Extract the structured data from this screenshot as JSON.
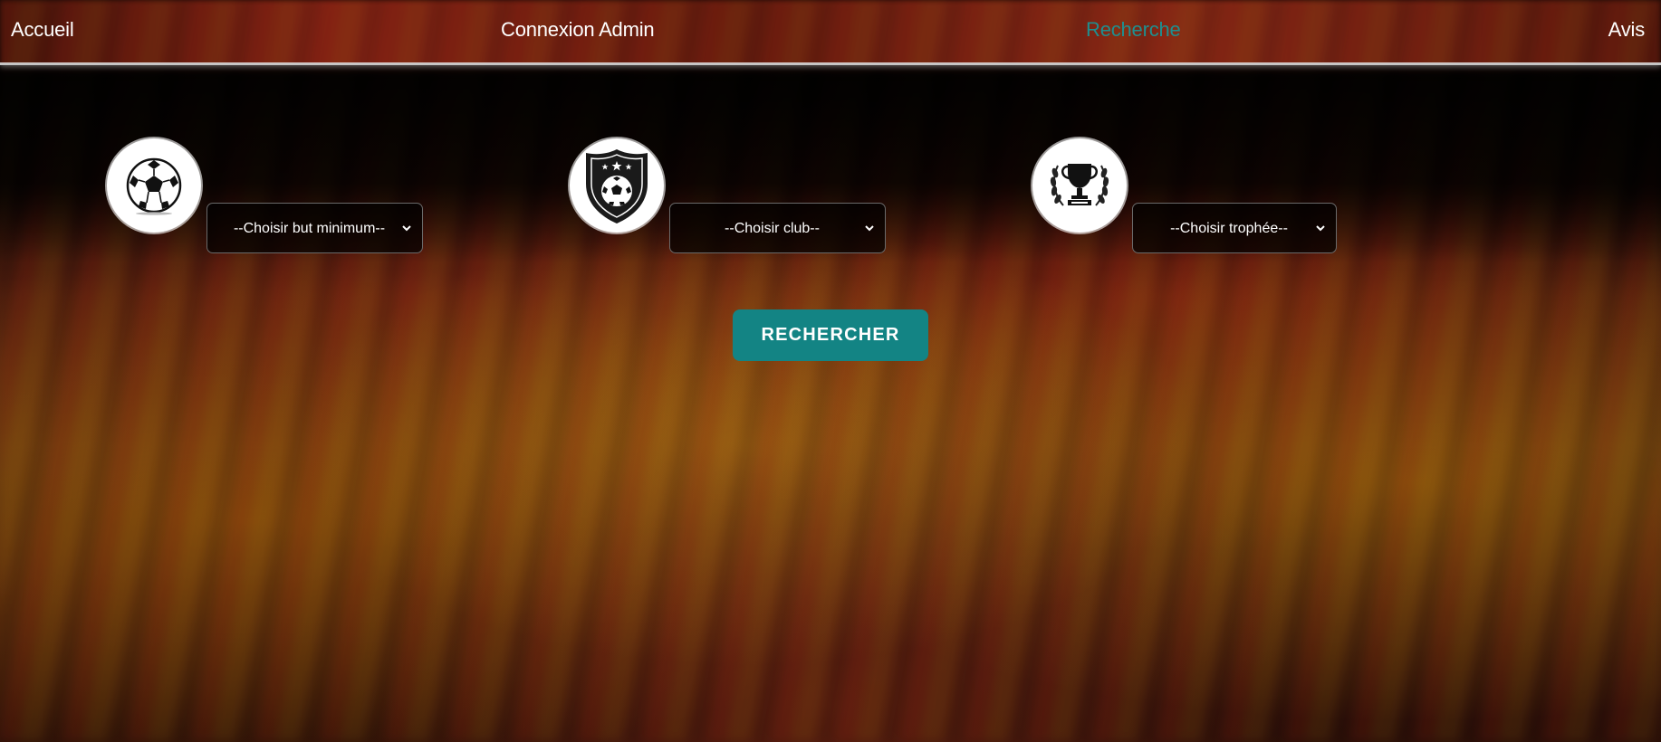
{
  "nav": {
    "home": "Accueil",
    "admin": "Connexion Admin",
    "search": "Recherche",
    "reviews": "Avis",
    "active_color": "#1e8f8f"
  },
  "filters": {
    "goals": {
      "icon": "soccer-ball-icon",
      "selected": "--Choisir but minimum--"
    },
    "club": {
      "icon": "club-crest-icon",
      "selected": "--Choisir club--"
    },
    "trophy": {
      "icon": "trophy-icon",
      "selected": "--Choisir trophée--"
    }
  },
  "search_button": {
    "label": "RECHERCHER",
    "color": "#138484"
  }
}
